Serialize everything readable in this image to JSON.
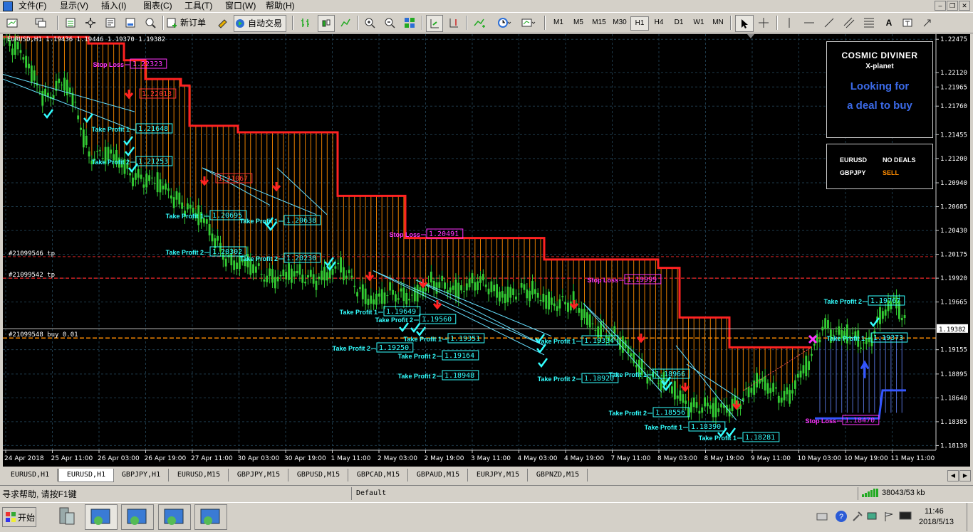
{
  "menu": {
    "file": "文件(F)",
    "view": "显示(V)",
    "insert": "插入(I)",
    "charts": "图表(C)",
    "tools": "工具(T)",
    "window": "窗口(W)",
    "help": "帮助(H)"
  },
  "toolbar": {
    "new_order": "新订单",
    "autotrading": "自动交易",
    "timeframes": [
      "M1",
      "M5",
      "M15",
      "M30",
      "H1",
      "H4",
      "D1",
      "W1",
      "MN"
    ],
    "active_timeframe": "H1"
  },
  "chart": {
    "header": "EURUSD,H1  1.19436 1.19446 1.19370 1.19382",
    "current_price": "1.19382",
    "price_labels": [
      "1.22475",
      "1.22120",
      "1.21965",
      "1.21760",
      "1.21455",
      "1.21200",
      "1.20940",
      "1.20685",
      "1.20430",
      "1.20175",
      "1.19920",
      "1.19665",
      "1.19382",
      "1.19155",
      "1.18895",
      "1.18640",
      "1.18385",
      "1.18130"
    ],
    "time_labels": [
      "24 Apr 2018",
      "25 Apr 11:00",
      "26 Apr 03:00",
      "26 Apr 19:00",
      "27 Apr 11:00",
      "30 Apr 03:00",
      "30 Apr 19:00",
      "1 May 11:00",
      "2 May 03:00",
      "2 May 19:00",
      "3 May 11:00",
      "4 May 03:00",
      "4 May 19:00",
      "7 May 11:00",
      "8 May 03:00",
      "8 May 19:00",
      "9 May 11:00",
      "10 May 03:00",
      "10 May 19:00",
      "11 May 11:00"
    ],
    "order_lines": [
      {
        "label": "#21099546 tp",
        "color": "#cc2222"
      },
      {
        "label": "#21099542 tp",
        "color": "#cc2222"
      },
      {
        "label": "#21099548 buy 0.01",
        "color": "#ff8c00"
      }
    ],
    "stop_loss_labels": [
      {
        "text": "Stop Loss",
        "price": "1.22323"
      },
      {
        "text": "Stop Loss",
        "price": "1.20491"
      },
      {
        "text": "Stop Loss",
        "price": "1.19999"
      },
      {
        "text": "Stop Loss",
        "price": "1.18470"
      }
    ],
    "stop_loss_markers": [
      {
        "price": "1.22013"
      },
      {
        "price": "1.21067"
      }
    ],
    "take_profit_labels": [
      {
        "text": "Take Profit 1",
        "price": "1.21648"
      },
      {
        "text": "Take Profit 2",
        "price": "1.21253"
      },
      {
        "text": "Take Profit 1",
        "price": "1.20695"
      },
      {
        "text": "Take Profit 2",
        "price": "1.20302"
      },
      {
        "text": "Take Profit 1",
        "price": "1.20638"
      },
      {
        "text": "Take Profit 2",
        "price": "1.20230"
      },
      {
        "text": "Take Profit 1",
        "price": "1.19649"
      },
      {
        "text": "Take Profit 2",
        "price": "1.19560"
      },
      {
        "text": "Take Profit 2",
        "price": "1.19250"
      },
      {
        "text": "Take Profit 1",
        "price": "1.19351"
      },
      {
        "text": "Take Profit 2",
        "price": "1.19164"
      },
      {
        "text": "Take Profit 2",
        "price": "1.18948"
      },
      {
        "text": "Take Profit 1",
        "price": "1.19334"
      },
      {
        "text": "Take Profit 2",
        "price": "1.18920"
      },
      {
        "text": "Take Profit 1",
        "price": "1.18966"
      },
      {
        "text": "Take Profit 2",
        "price": "1.18556"
      },
      {
        "text": "Take Profit 1",
        "price": "1.18390"
      },
      {
        "text": "Take Profit 1",
        "price": "1.18281"
      },
      {
        "text": "Take Profit 2",
        "price": "1.19767"
      },
      {
        "text": "Take Profit 1",
        "price": "1.19373"
      }
    ],
    "panel": {
      "title": "COSMIC DIVINER",
      "subtitle": "X-planet",
      "message_line1": "Looking for",
      "message_line2": "a deal to buy"
    },
    "deals": [
      {
        "symbol": "EURUSD",
        "status": "NO DEALS",
        "color": "#ffffff"
      },
      {
        "symbol": "GBPJPY",
        "status": "SELL",
        "color": "#ff8c00"
      }
    ]
  },
  "symbol_tabs": [
    "EURUSD,H1",
    "EURUSD,H1",
    "GBPJPY,H1",
    "EURUSD,M15",
    "GBPJPY,M15",
    "GBPUSD,M15",
    "GBPCAD,M15",
    "GBPAUD,M15",
    "EURJPY,M15",
    "GBPNZD,M15"
  ],
  "active_symbol_tab": 1,
  "status": {
    "help": "寻求帮助, 请按F1键",
    "profile": "Default",
    "traffic": "38043/53 kb"
  },
  "taskbar": {
    "start": "开始",
    "time": "11:46",
    "date": "2018/5/13"
  },
  "colors": {
    "candle_bull": "#33cc33",
    "resistance": "#ff2222",
    "band": "#ff8c00",
    "support": "#3355ff",
    "stop_loss": "#ff33ff",
    "take_profit": "#33ffff",
    "grid": "#1e3a4a"
  }
}
